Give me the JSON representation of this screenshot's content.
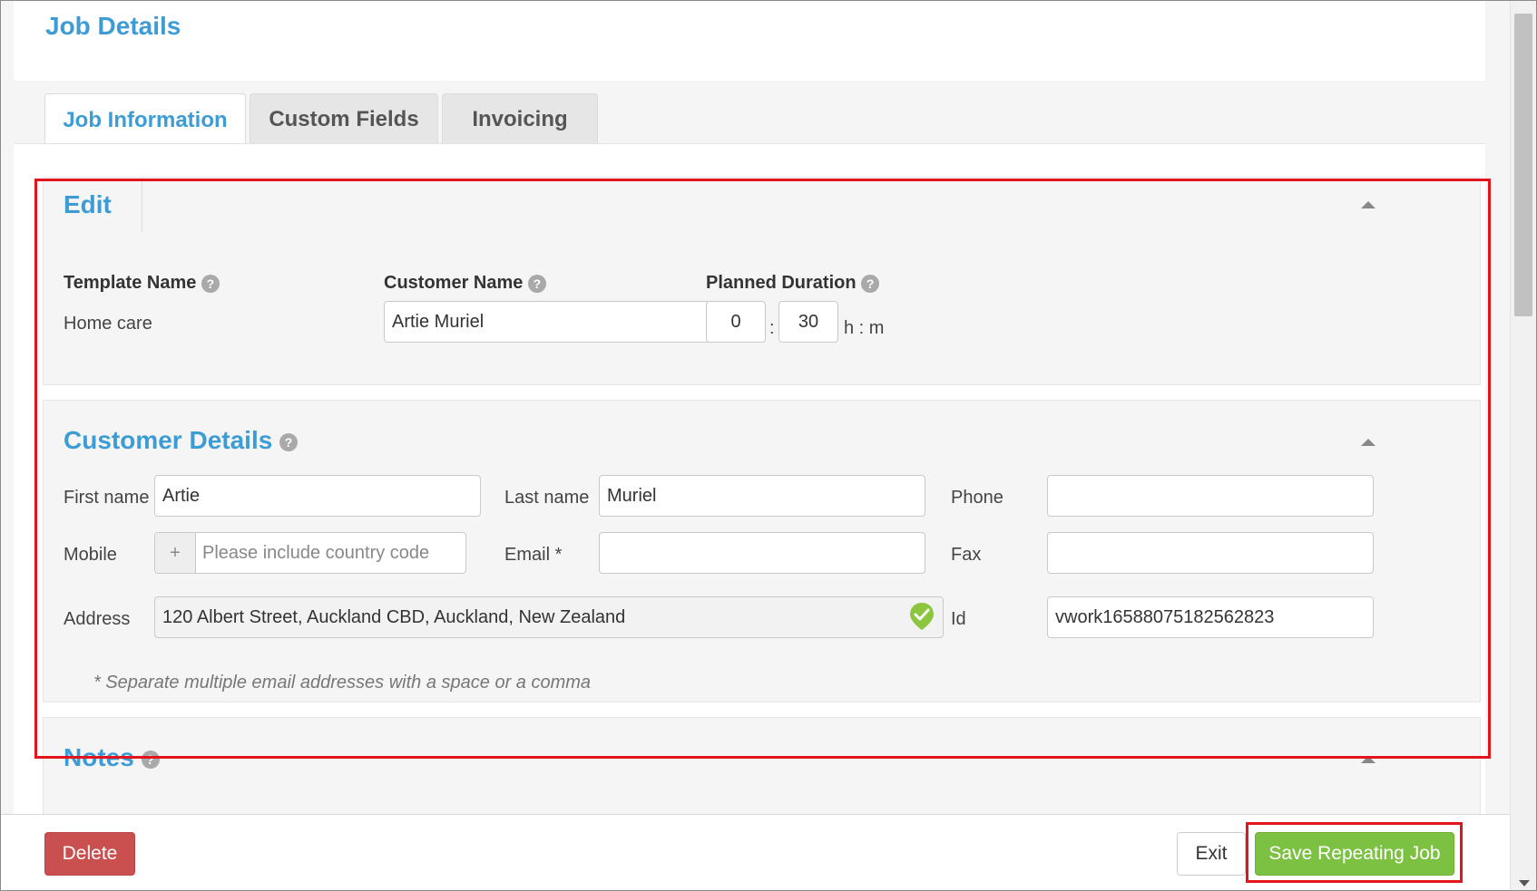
{
  "page": {
    "title": "Job Details"
  },
  "tabs": [
    {
      "label": "Job Information",
      "active": true
    },
    {
      "label": "Custom Fields",
      "active": false
    },
    {
      "label": "Invoicing",
      "active": false
    }
  ],
  "edit_section": {
    "title": "Edit",
    "template_name": {
      "label": "Template Name",
      "value": "Home care"
    },
    "customer_name": {
      "label": "Customer Name",
      "value": "Artie Muriel"
    },
    "planned_duration": {
      "label": "Planned Duration",
      "hours": "0",
      "separator": ":",
      "minutes": "30",
      "unit": "h : m"
    }
  },
  "customer_details": {
    "title": "Customer Details",
    "first_name": {
      "label": "First name",
      "value": "Artie"
    },
    "last_name": {
      "label": "Last name",
      "value": "Muriel"
    },
    "phone": {
      "label": "Phone",
      "value": ""
    },
    "mobile": {
      "label": "Mobile",
      "prefix": "+",
      "placeholder": "Please include country code"
    },
    "email": {
      "label": "Email *",
      "value": ""
    },
    "fax": {
      "label": "Fax",
      "value": ""
    },
    "address": {
      "label": "Address",
      "value": "120 Albert Street, Auckland CBD, Auckland, New Zealand",
      "status_icon": "verified-location-icon"
    },
    "id": {
      "label": "Id",
      "value": "vwork16588075182562823"
    },
    "note": "* Separate multiple email addresses with a space or a comma"
  },
  "notes_section": {
    "title": "Notes"
  },
  "footer": {
    "delete_label": "Delete",
    "exit_label": "Exit",
    "save_label": "Save Repeating Job"
  },
  "colors": {
    "accent": "#3e9cd4",
    "highlight": "#e2141e",
    "save": "#7dc143",
    "delete": "#c9504f"
  }
}
